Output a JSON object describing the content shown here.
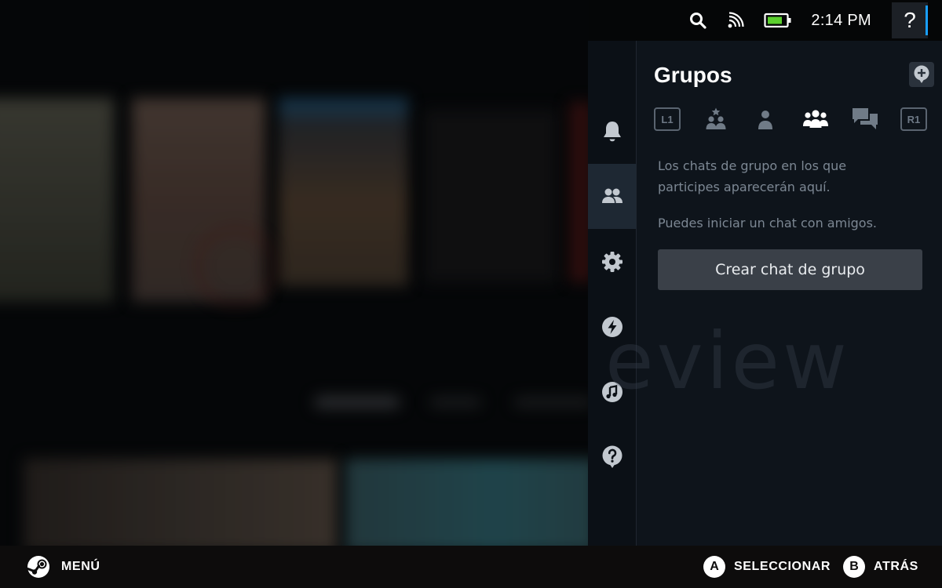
{
  "status_bar": {
    "icons": [
      "search-icon",
      "network-icon",
      "battery-icon"
    ],
    "time": "2:14 PM",
    "help_label": "?"
  },
  "side_rail": {
    "items": [
      {
        "name": "notifications",
        "icon": "bell-icon",
        "active": false
      },
      {
        "name": "friends",
        "icon": "friends-icon",
        "active": true
      },
      {
        "name": "settings",
        "icon": "gear-icon",
        "active": false
      },
      {
        "name": "performance",
        "icon": "bolt-icon",
        "active": false
      },
      {
        "name": "music",
        "icon": "music-note-icon",
        "active": false
      },
      {
        "name": "help",
        "icon": "question-bubble-icon",
        "active": false
      }
    ]
  },
  "panel": {
    "title": "Grupos",
    "new_button_icon": "add-chat-icon",
    "tabs": {
      "left_shoulder": "L1",
      "right_shoulder": "R1",
      "items": [
        {
          "icon": "favorites-friends-icon",
          "active": false
        },
        {
          "icon": "person-icon",
          "active": false
        },
        {
          "icon": "group-icon",
          "active": true
        },
        {
          "icon": "chats-icon",
          "active": false
        }
      ]
    },
    "empty_message": "Los chats de grupo en los que participes aparecerán aquí.",
    "hint": "Puedes iniciar un chat con amigos.",
    "create_button": "Crear chat de grupo"
  },
  "bottom_bar": {
    "menu_label": "MENÚ",
    "select": {
      "button": "A",
      "label": "SELECCIONAR"
    },
    "back": {
      "button": "B",
      "label": "ATRÁS"
    }
  },
  "colors": {
    "accent": "#1a9fff",
    "panel_bg": "#0e141b",
    "rail_active": "#1e2833",
    "button_bg": "#3a4048",
    "muted_text": "#7c8793"
  }
}
